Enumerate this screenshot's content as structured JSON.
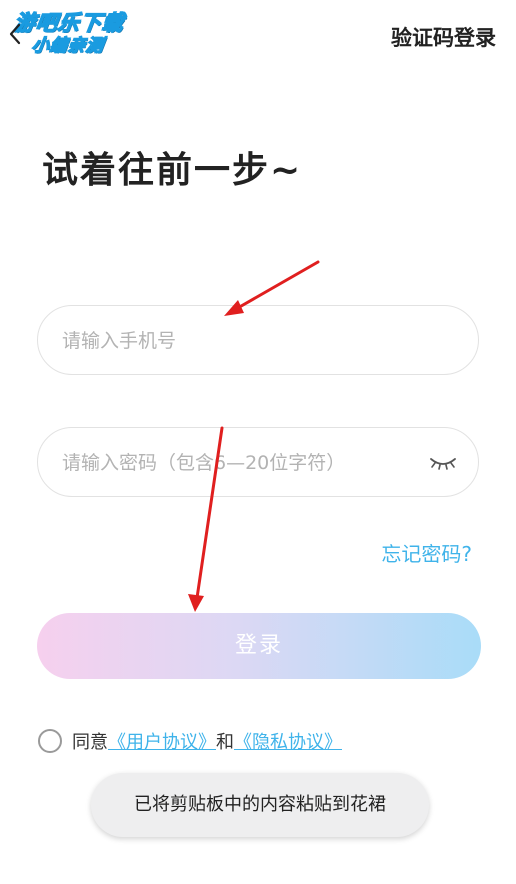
{
  "watermark": {
    "line1": "游吧乐下载",
    "line2": "小编亲测"
  },
  "header": {
    "back_icon": "chevron-left-icon",
    "sms_login_label": "验证码登录"
  },
  "title": "试着往前一步~",
  "phone_field": {
    "placeholder": "请输入手机号",
    "value": ""
  },
  "password_field": {
    "placeholder": "请输入密码（包含6—20位字符）",
    "value": "",
    "toggle_icon": "eye-closed-icon"
  },
  "forgot_password_label": "忘记密码?",
  "login_button_label": "登录",
  "agreement": {
    "prefix": "同意",
    "user_agreement": "《用户协议》",
    "conjunction": "和",
    "privacy_policy": "《隐私协议》"
  },
  "toast": "已将剪贴板中的内容粘贴到花裙",
  "colors": {
    "accent": "#3fb3ea",
    "button_gradient_start": "#f6d0ee",
    "button_gradient_end": "#a9dcf8",
    "annotation_arrow": "#e01f1f"
  }
}
